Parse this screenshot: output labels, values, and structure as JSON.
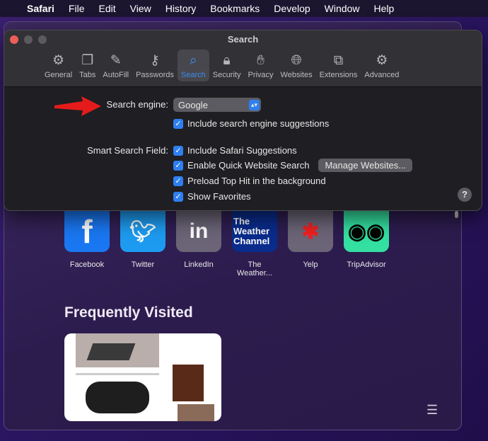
{
  "menubar": {
    "app": "Safari",
    "items": [
      "File",
      "Edit",
      "View",
      "History",
      "Bookmarks",
      "Develop",
      "Window",
      "Help"
    ]
  },
  "prefs": {
    "title": "Search",
    "tabs": [
      {
        "label": "General",
        "icon": "⚙"
      },
      {
        "label": "Tabs",
        "icon": "❐"
      },
      {
        "label": "AutoFill",
        "icon": "✎"
      },
      {
        "label": "Passwords",
        "icon": "⚷"
      },
      {
        "label": "Search",
        "icon": "⌕"
      },
      {
        "label": "Security",
        "icon": "🔒︎"
      },
      {
        "label": "Privacy",
        "icon": "✋︎"
      },
      {
        "label": "Websites",
        "icon": "🌐︎"
      },
      {
        "label": "Extensions",
        "icon": "⧉"
      },
      {
        "label": "Advanced",
        "icon": "⚙"
      }
    ],
    "search_engine_label": "Search engine:",
    "search_engine_value": "Google",
    "include_suggestions": "Include search engine suggestions",
    "smart_label": "Smart Search Field:",
    "opt1": "Include Safari Suggestions",
    "opt2": "Enable Quick Website Search",
    "manage": "Manage Websites...",
    "opt3": "Preload Top Hit in the background",
    "opt4": "Show Favorites",
    "help": "?"
  },
  "favorites": [
    {
      "label": "Facebook",
      "tile": "f",
      "bg": "#1a77f2"
    },
    {
      "label": "Twitter",
      "tile": "🐦︎",
      "bg": "#1d9bf0"
    },
    {
      "label": "LinkedIn",
      "tile": "in",
      "bg": "#6b6577"
    },
    {
      "label": "The Weather...",
      "tile": "The Weather Channel",
      "bg": "#0a2c8c"
    },
    {
      "label": "Yelp",
      "tile": "✱",
      "bg": "#6b6577"
    },
    {
      "label": "TripAdvisor",
      "tile": "◉◉",
      "bg": "#34e0a1"
    }
  ],
  "frequently_visited": "Frequently Visited"
}
